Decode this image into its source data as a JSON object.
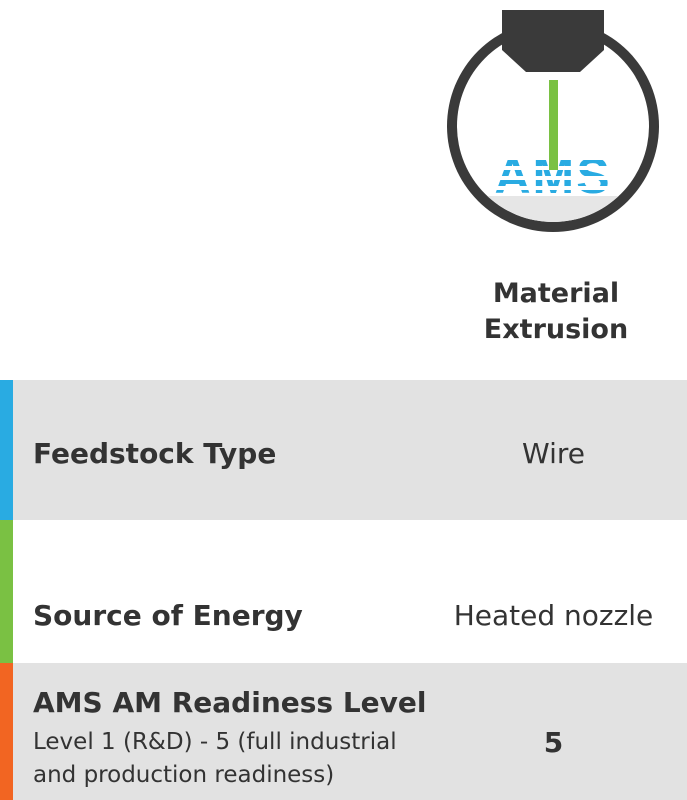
{
  "header": {
    "logo_text": "AMS",
    "method_title_line1": "Material",
    "method_title_line2": "Extrusion"
  },
  "rows": [
    {
      "label": "Feedstock Type",
      "value": "Wire",
      "accent_color": "#29abe2"
    },
    {
      "label": "Source of Energy",
      "value": "Heated nozzle",
      "accent_color": "#7ac143"
    },
    {
      "label": "AMS AM Readiness Level",
      "sublabel": "Level 1 (R&D) - 5 (full industrial and production readiness)",
      "value": "5",
      "accent_color": "#f26522"
    }
  ],
  "colors": {
    "row_shaded": "#e2e2e2",
    "text": "#333333",
    "logo_ring": "#3a3a3a",
    "logo_filament": "#7ac143",
    "logo_text": "#29abe2"
  }
}
